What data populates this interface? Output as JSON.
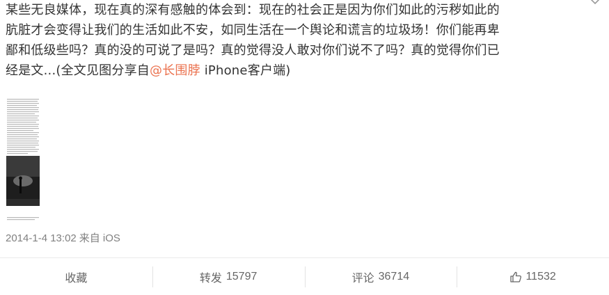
{
  "post": {
    "lines": [
      "某些无良媒体，现在真的深有感触的体会到：现在的社会正是因为你们如此的污秽如此的",
      "肮脏才会变得让我们的生活如此不安，如同生活在一个舆论和谎言的垃圾场！你们能再卑",
      "鄙和低级些吗？真的没的可说了是吗？真的觉得没人敢对你们说不了吗？真的觉得你们已"
    ],
    "last_line_prefix": "经是文...(全文见图分享自",
    "mention": "@长围脖",
    "last_line_suffix": " iPhone客户端)"
  },
  "meta": {
    "date": "2014-1-4 13:02",
    "source": "来自 iOS"
  },
  "actions": {
    "favorite_label": "收藏",
    "repost_label": "转发",
    "repost_count": "15797",
    "comment_label": "评论",
    "comment_count": "36714",
    "like_count": "11532"
  },
  "icons": {
    "more": "chevron-down-icon",
    "like": "thumbs-up-icon"
  },
  "colors": {
    "text": "#333333",
    "mention": "#eb7350",
    "meta": "#808080",
    "action": "#666666"
  }
}
